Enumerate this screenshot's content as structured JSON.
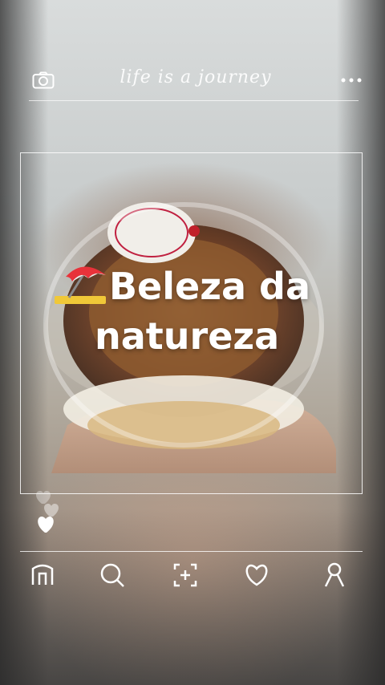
{
  "header": {
    "brand_text": "life is a journey",
    "icons": [
      "camera-icon",
      "more-dots-icon"
    ]
  },
  "post": {
    "title_line1": "Beleza da",
    "title_line2": "natureza",
    "title_emoji": "beach-umbrella-icon"
  },
  "reactions": {
    "icons": [
      "heart-outline-icon",
      "heart-outline-icon",
      "heart-filled-icon"
    ]
  },
  "bottom_nav": {
    "items": [
      "home-icon",
      "search-icon",
      "add-post-icon",
      "likes-icon",
      "profile-icon"
    ]
  },
  "colors": {
    "overlay_line": "#ffffff",
    "text": "#ffffff"
  }
}
